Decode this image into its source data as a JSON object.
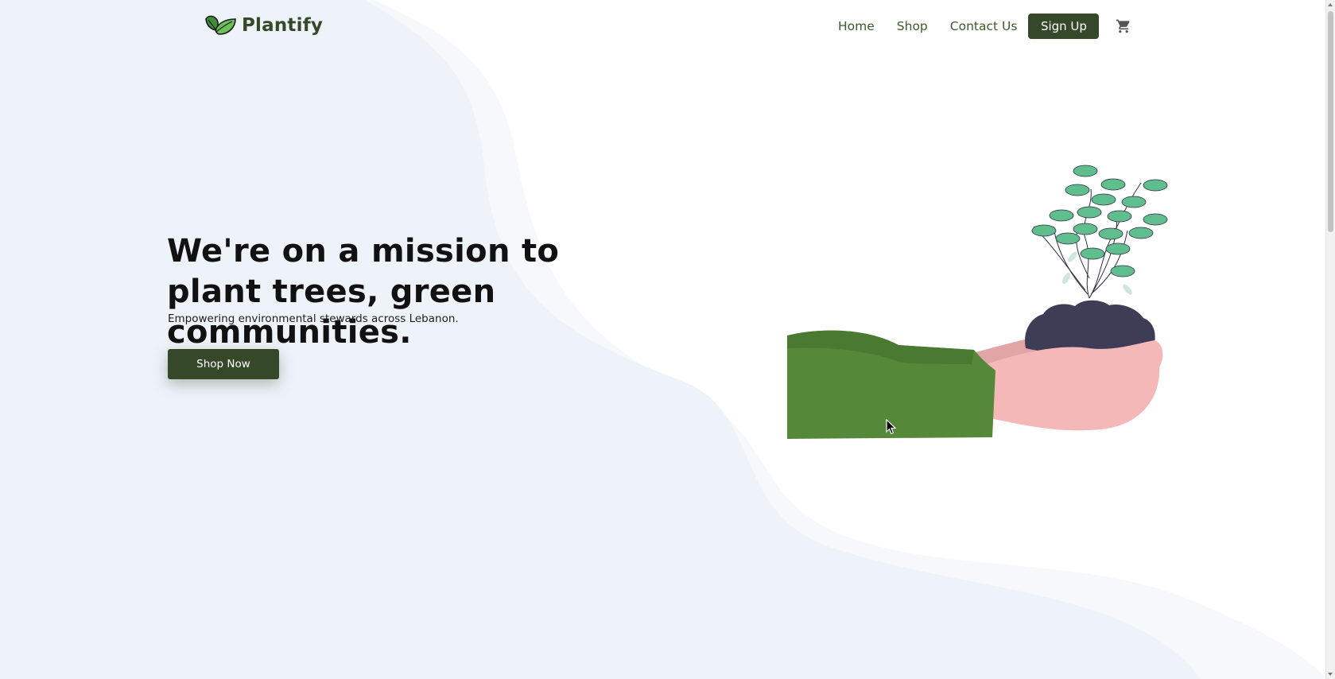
{
  "navbar": {
    "brand_name": "Plantify",
    "links": {
      "home": "Home",
      "shop": "Shop",
      "contact": "Contact Us"
    },
    "signup_label": "Sign Up",
    "cart_icon": "shopping-cart-icon"
  },
  "hero": {
    "title": "We're on a mission to plant trees, green communities.",
    "subtitle": "Empowering environmental stewards across Lebanon.",
    "cta_label": "Shop Now"
  },
  "colors": {
    "brand_green": "#35492a",
    "nav_link": "#3d5a2a",
    "background_wave": "#eef3fa",
    "sleeve_green": "#558838",
    "hand_pink": "#f4b8b8",
    "soil": "#3f3d56",
    "leaf": "#5fbd8e"
  },
  "illustration": {
    "icon": "hands-holding-plant-illustration"
  }
}
